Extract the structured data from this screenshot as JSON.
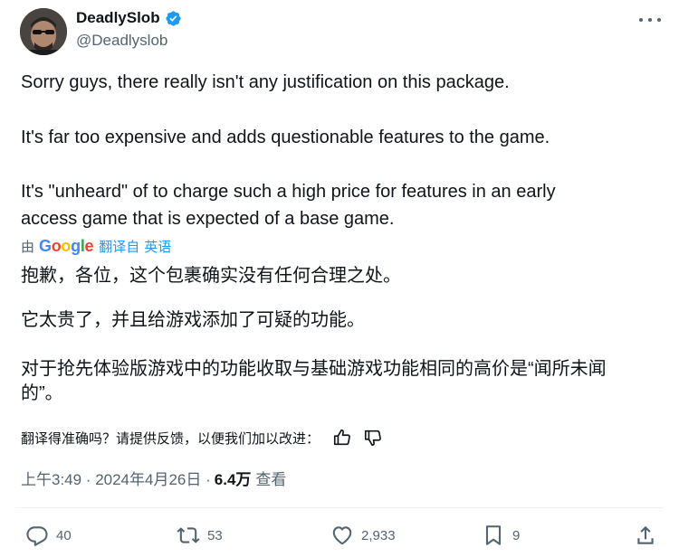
{
  "author": {
    "display_name": "DeadlySlob",
    "handle": "@Deadlyslob",
    "verified_icon": "verified-badge-icon",
    "avatar": "user-avatar"
  },
  "tweet": {
    "paragraphs_original": [
      "Sorry guys, there really isn't any justification on this package.",
      "It's far too expensive and adds questionable features to the game.",
      "It's \"unheard\" of to charge such a high price for features in an early",
      "access game that is expected of a base game."
    ],
    "translation_bar": {
      "by": "由",
      "provider_letters": [
        "G",
        "o",
        "o",
        "g",
        "l",
        "e"
      ],
      "translated_from": "翻译自",
      "language": "英语"
    },
    "paragraphs_translated": [
      "抱歉，各位，这个包裹确实没有任何合理之处。",
      "它太贵了，并且给游戏添加了可疑的功能。",
      "对于抢先体验版游戏中的功能收取与基础游戏功能相同的高价是“闻所未闻",
      "的”。"
    ],
    "feedback_prompt": "翻译得准确吗？请提供反馈，以便我们加以改进："
  },
  "meta": {
    "time_date": "上午3:49 · 2024年4月26日 ·",
    "views": "6.4万",
    "views_label": "查看"
  },
  "actions": {
    "replies": "40",
    "reposts": "53",
    "likes": "2,933",
    "bookmarks": "9"
  },
  "colors": {
    "text": "#0f1419",
    "secondary": "#536471",
    "link": "#1d9bf0",
    "verified": "#1d9bf0"
  }
}
